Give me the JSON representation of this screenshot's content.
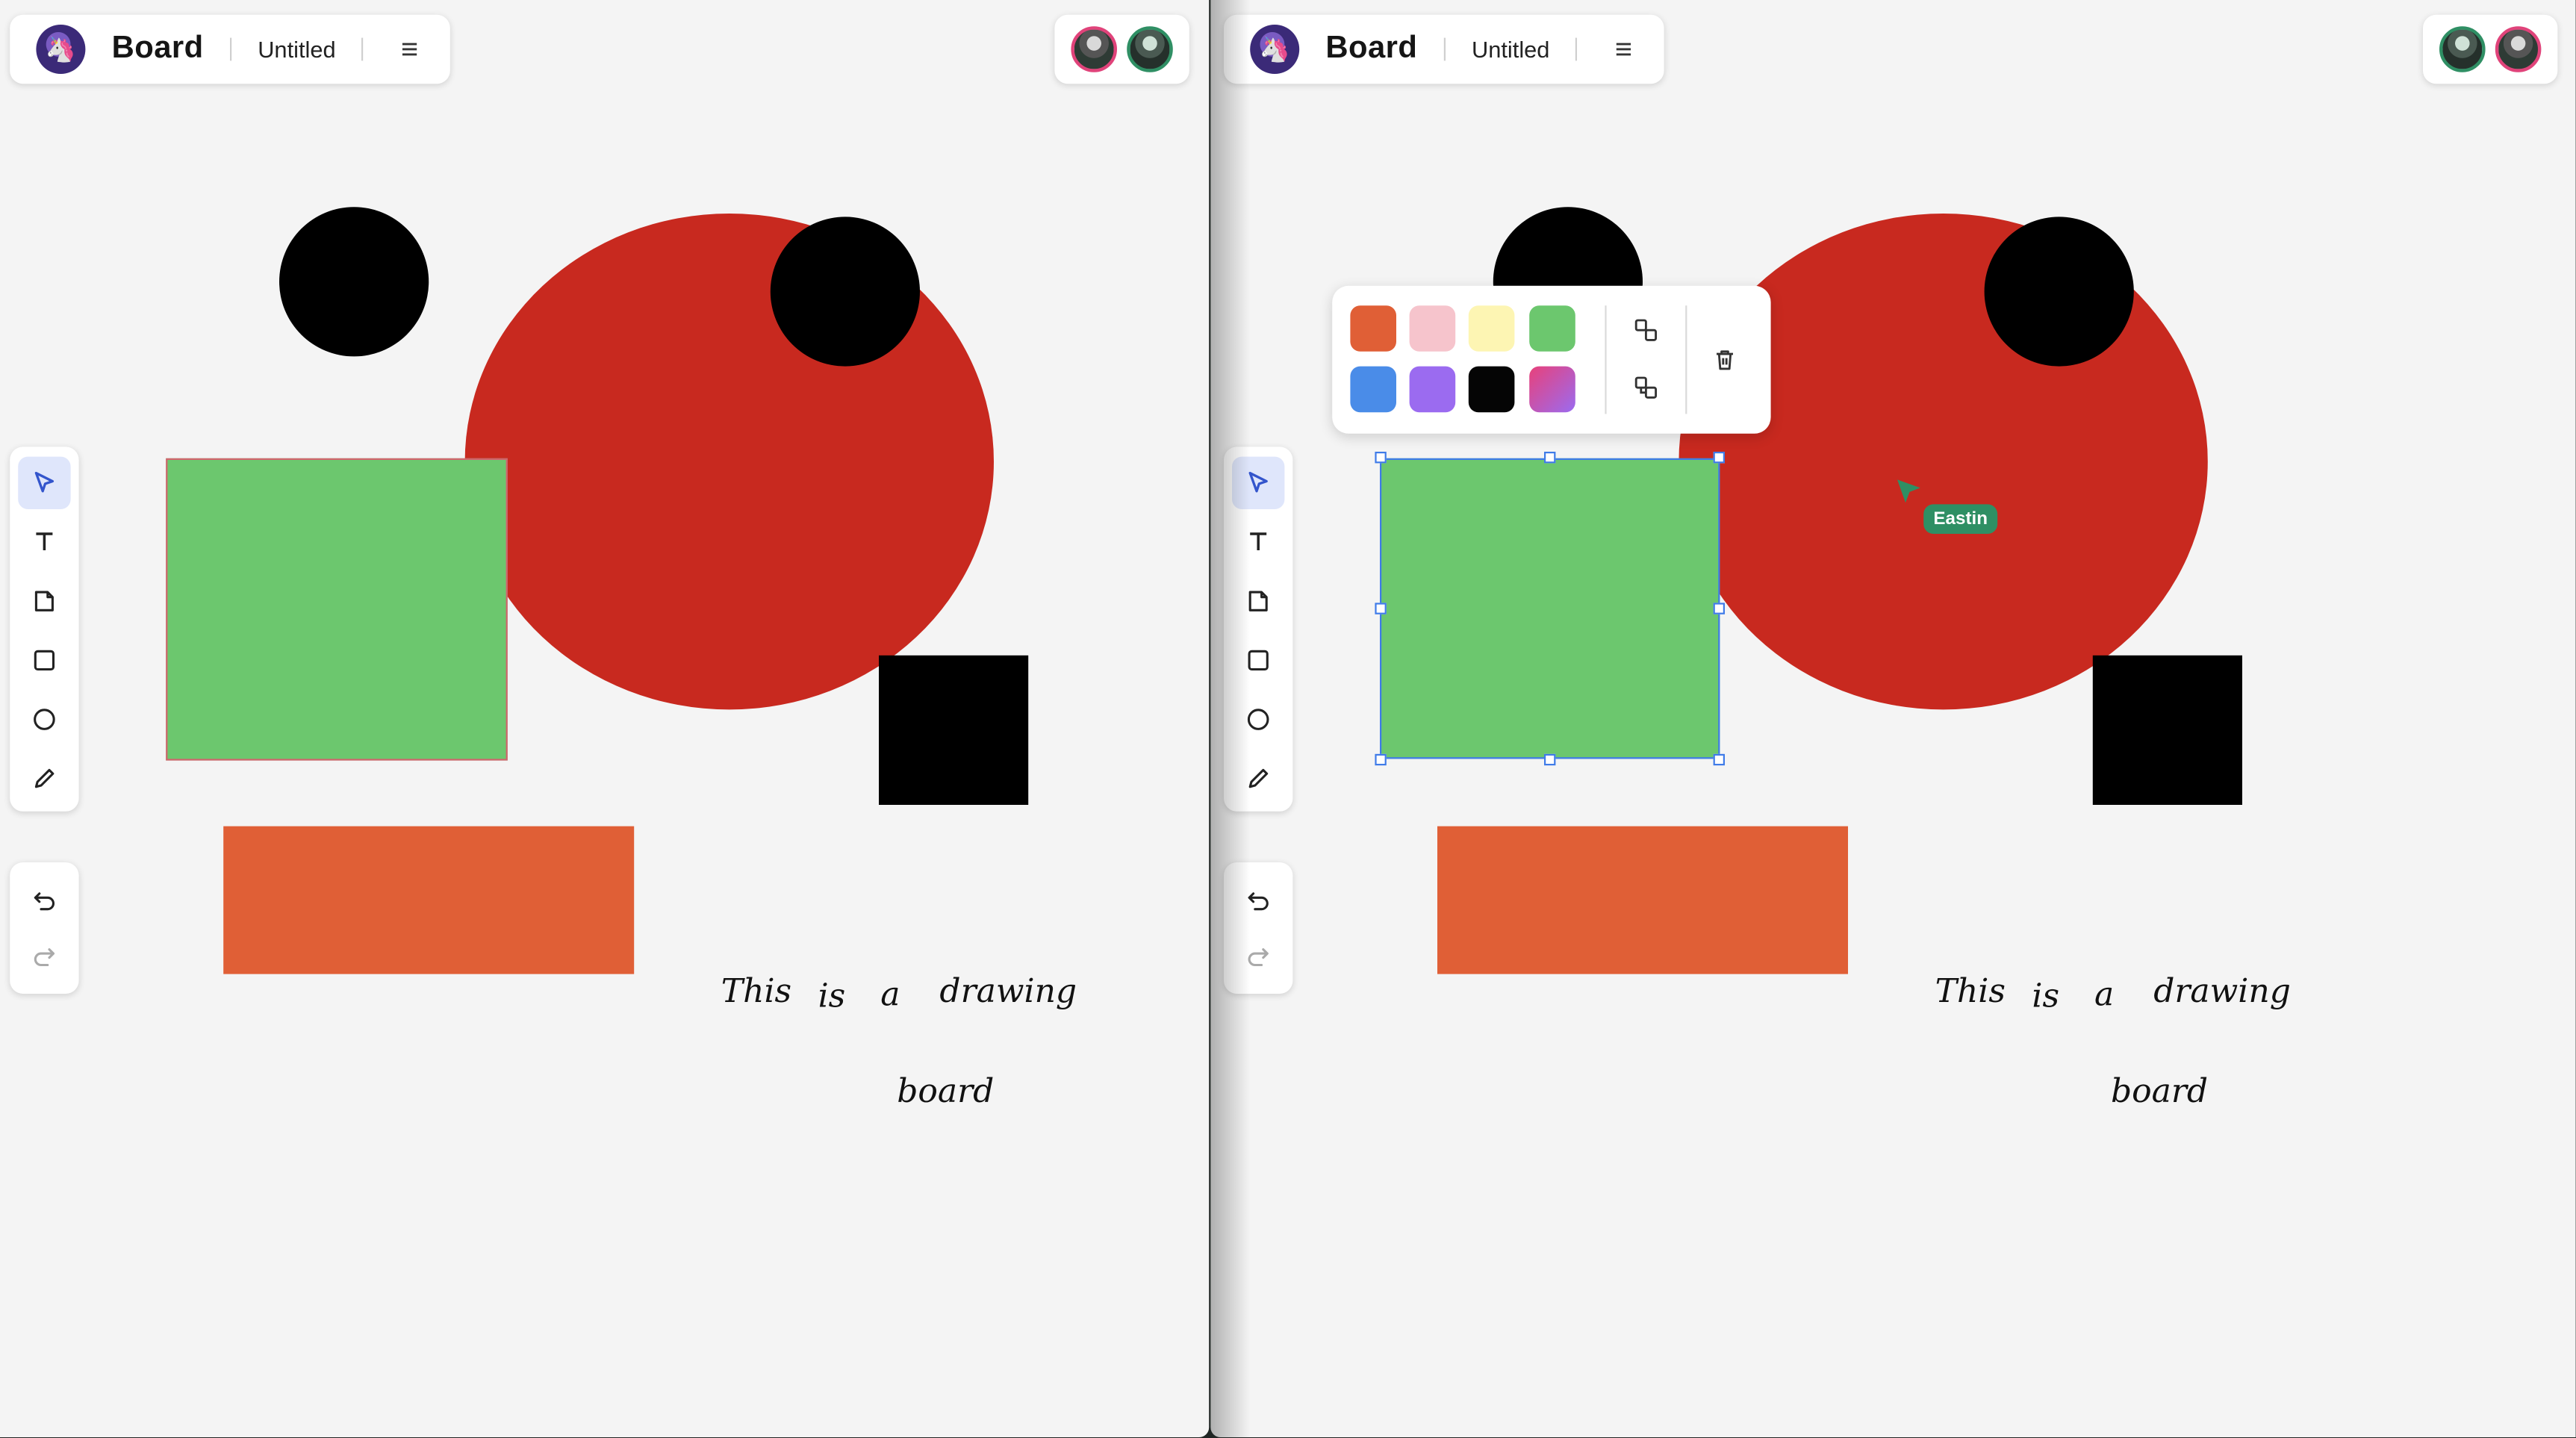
{
  "app": {
    "title": "Board",
    "doc_title": "Untitled"
  },
  "icons": {
    "logo": "unicorn-logo-icon",
    "menu": "hamburger-menu-icon",
    "tools": [
      "select-pointer-icon",
      "text-icon",
      "sticky-note-icon",
      "rectangle-icon",
      "ellipse-icon",
      "pencil-icon"
    ],
    "history": [
      "undo-icon",
      "redo-icon"
    ],
    "popup_actions": [
      "bring-forward-icon",
      "send-backward-icon",
      "trash-icon"
    ]
  },
  "board": {
    "text_words": [
      "This",
      "is",
      "a",
      "drawing",
      "board"
    ],
    "colors": {
      "background": "#f4f4f4",
      "red": "#c8291f",
      "green": "#6cc76e",
      "orange": "#e05f36",
      "black": "#000000",
      "selection": "#3f7be8"
    }
  },
  "popup": {
    "swatches": [
      "#e05f36",
      "#f6c4cc",
      "#fdf5b3",
      "#6cc76e",
      "#4a8ce8",
      "#9b6bf0",
      "#050505",
      "gradient:#e8417a-#9b6bf0"
    ]
  },
  "remote_cursor": {
    "name": "Eastin",
    "color": "#2f8f64"
  }
}
